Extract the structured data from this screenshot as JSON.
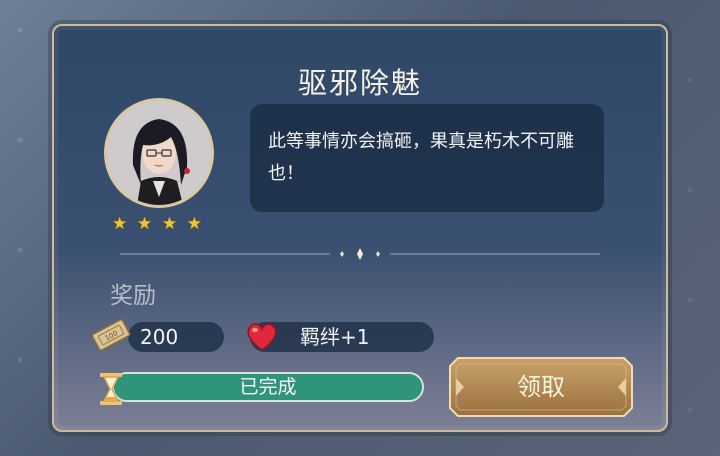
{
  "task": {
    "title": "驱邪除魅",
    "dialogue": "此等事情亦会搞砸，果真是朽木不可雕也！",
    "star_rating": 4
  },
  "rewards": {
    "label": "奖励",
    "items": [
      {
        "icon": "coupon-icon",
        "value": "200"
      },
      {
        "icon": "heart-icon",
        "value": "羁绊+1"
      }
    ]
  },
  "progress": {
    "status_text": "已完成",
    "fraction": 1.0
  },
  "actions": {
    "claim_label": "领取"
  },
  "colors": {
    "panel_border": "#cdbb95",
    "progress_fill": "#2f9479",
    "star": "#f0c33b",
    "heart": "#e0283a",
    "button": "#b48a52"
  }
}
